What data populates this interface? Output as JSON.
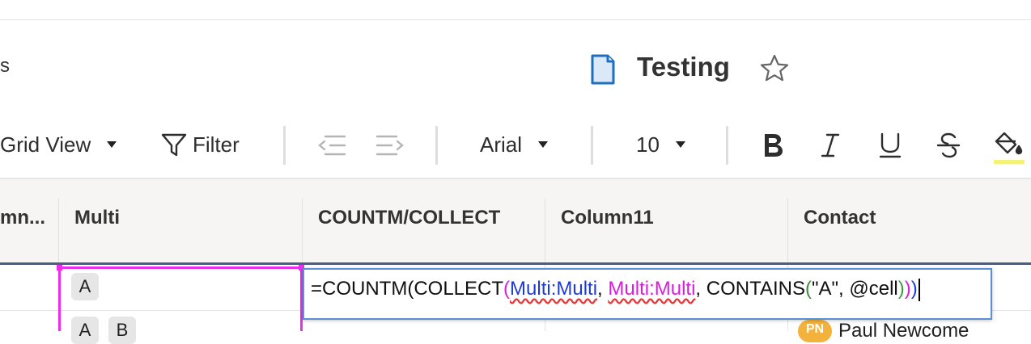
{
  "breadcrumb_tail": "s",
  "sheet": {
    "title": "Testing"
  },
  "toolbar": {
    "view_label": "Grid View",
    "filter_label": "Filter",
    "font_name": "Arial",
    "font_size": "10"
  },
  "columns": [
    {
      "label": "mn..."
    },
    {
      "label": "Multi"
    },
    {
      "label": "COUNTM/COLLECT"
    },
    {
      "label": "Column11"
    },
    {
      "label": "Contact"
    }
  ],
  "rows": [
    {
      "multi": [
        "A"
      ]
    },
    {
      "multi": [
        "A",
        "B"
      ],
      "contact_initials": "PN",
      "contact_name": "Paul Newcome"
    }
  ],
  "formula": {
    "p1": "=COUNTM(COLLECT",
    "open1": "(",
    "ref1": "Multi:Multi",
    "comma1": ", ",
    "ref2": "Multi:Multi",
    "mid": ", CONTAINS",
    "open2": "(",
    "arg": "\"A\", @cell",
    "close2": ")",
    "close1": ")",
    "close0": ")"
  },
  "colors": {
    "selection": "#ee2cee",
    "formula_border": "#5b8fd6",
    "header_rule": "#4a5d87",
    "highlight_swatch": "#f5f07a"
  },
  "icons": [
    "sheet-icon",
    "star-icon",
    "filter-icon",
    "outdent-icon",
    "indent-icon",
    "bold-icon",
    "italic-icon",
    "underline-icon",
    "strikethrough-icon",
    "fill-color-icon"
  ]
}
